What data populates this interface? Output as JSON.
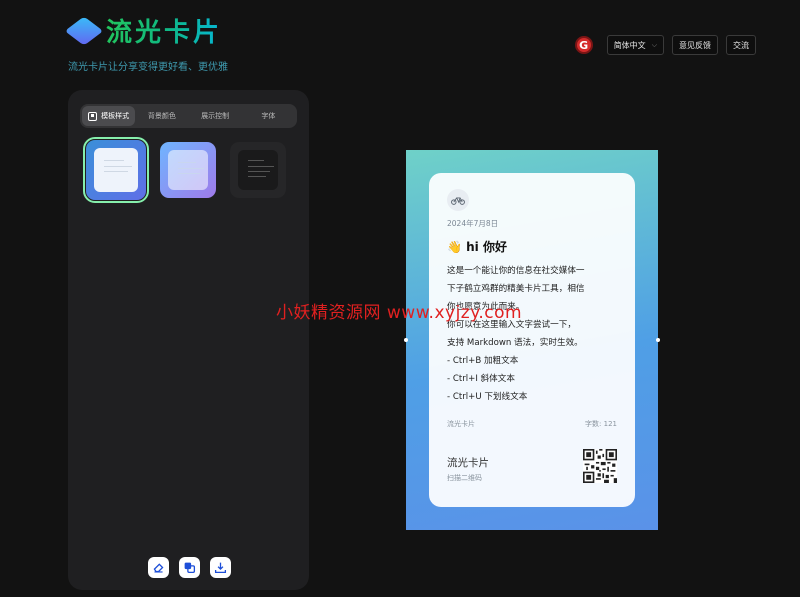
{
  "brand": {
    "title": "流光卡片",
    "tagline": "流光卡片让分享变得更好看、更优雅"
  },
  "top_bar": {
    "icon": "round-g-icon",
    "icon_letter": "G",
    "language": "简体中文",
    "feedback": "意见反馈",
    "discuss": "交流"
  },
  "tabs": [
    {
      "label": "模板样式",
      "active": true
    },
    {
      "label": "背景颜色",
      "active": false
    },
    {
      "label": "展示控制",
      "active": false
    },
    {
      "label": "字体",
      "active": false
    }
  ],
  "panel_actions": [
    "eraser-icon",
    "copy-icon",
    "download-icon"
  ],
  "card": {
    "date": "2024年7月8日",
    "emoji": "👋",
    "title": "hi 你好",
    "body": [
      "这是一个能让你的信息在社交媒体一",
      "下子鹤立鸡群的精美卡片工具，相信",
      "你也愿意为此而来。",
      "你可以在这里输入文字尝试一下，",
      "支持 Markdown 语法，实时生效。",
      "- Ctrl+B 加粗文本",
      "- Ctrl+I 斜体文本",
      "- Ctrl+U 下划线文本"
    ],
    "author": "流光卡片",
    "word_count": "字数: 121",
    "footer_brand": "流光卡片",
    "footer_scan": "扫描二维码"
  },
  "watermark": "小妖精资源网 www.xyjzy.com",
  "colors": {
    "accent": "#22c55e",
    "preview_top": "#6fd1c8",
    "preview_bottom": "#5a92e8",
    "watermark": "#e02020"
  }
}
